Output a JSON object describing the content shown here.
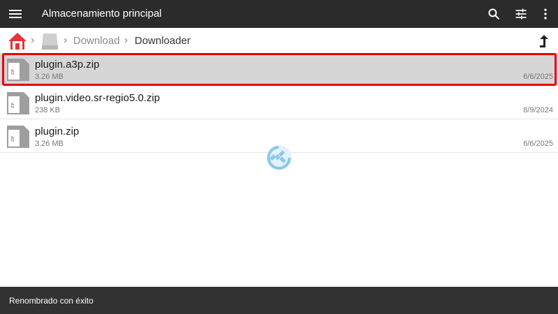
{
  "topbar": {
    "title": "Almacenamiento principal",
    "icons": [
      "menu-icon",
      "search-icon",
      "filter-icon",
      "more-vert-icon"
    ]
  },
  "breadcrumb": {
    "home_icon": "home-icon",
    "drive_icon": "drive-icon",
    "items": [
      "Download",
      "Downloader"
    ],
    "up_icon": "up-arrow-icon"
  },
  "files": [
    {
      "name": "plugin.a3p.zip",
      "size": "3.26 MB",
      "date": "6/6/2025",
      "selected": true
    },
    {
      "name": "plugin.video.sr-regio5.0.zip",
      "size": "238 KB",
      "date": "8/9/2024",
      "selected": false
    },
    {
      "name": "plugin.zip",
      "size": "3.26 MB",
      "date": "6/6/2025",
      "selected": false
    }
  ],
  "snackbar": {
    "message": "Renombrado con éxito"
  },
  "colors": {
    "topbar": "#2b2b2b",
    "selection_border": "#e8000b",
    "selected_row": "#d6d6d6",
    "snackbar": "#323232",
    "home_red": "#e8333b",
    "loader_blue": "#8cc8ea"
  }
}
